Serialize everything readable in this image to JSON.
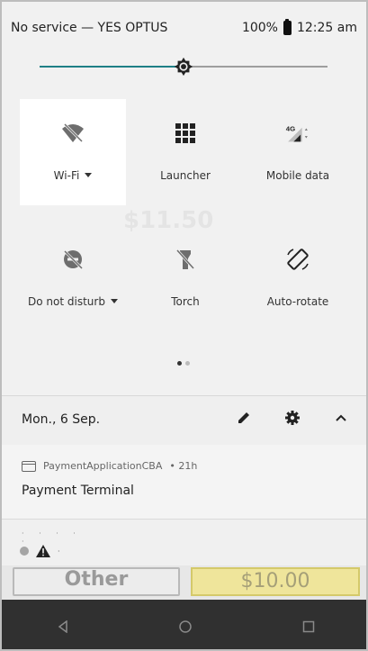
{
  "status_bar": {
    "carrier": "No service — YES OPTUS",
    "battery": "100%",
    "time": "12:25 am"
  },
  "brightness": {
    "level": 0.5
  },
  "quick_settings": {
    "tiles": [
      {
        "label": "Wi-Fi",
        "icon": "wifi-off-icon",
        "active": true,
        "has_dropdown": true
      },
      {
        "label": "Launcher",
        "icon": "launcher-grid-icon",
        "active": false,
        "has_dropdown": false
      },
      {
        "label": "Mobile data",
        "icon": "mobile-data-icon",
        "active": false,
        "has_dropdown": false
      },
      {
        "label": "Do not disturb",
        "icon": "do-not-disturb-off-icon",
        "active": false,
        "has_dropdown": true
      },
      {
        "label": "Torch",
        "icon": "torch-off-icon",
        "active": false,
        "has_dropdown": false
      },
      {
        "label": "Auto-rotate",
        "icon": "auto-rotate-icon",
        "active": false,
        "has_dropdown": false
      }
    ],
    "mobile_network_badge": "4G",
    "page_indicator": {
      "pages": 2,
      "current": 1
    }
  },
  "date_row": {
    "date": "Mon., 6 Sep."
  },
  "notifications": [
    {
      "app": "PaymentApplicationCBA",
      "age": "• 21h",
      "title": "Payment Terminal"
    }
  ],
  "underlay": {
    "ghost_amount": "$11.50",
    "other_button": "Other",
    "amount_button": "$10.00"
  },
  "colors": {
    "accent": "#1f7f86",
    "nav_bar": "#303030"
  }
}
